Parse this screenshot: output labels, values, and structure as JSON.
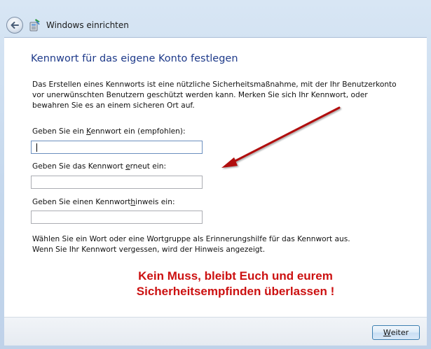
{
  "window": {
    "title": "Windows einrichten"
  },
  "page": {
    "heading": "Kennwort für das eigene Konto festlegen",
    "intro_lines": [
      "Das Erstellen eines Kennworts ist eine nützliche Sicherheitsmaßnahme, mit der Ihr Benutzerkonto",
      "vor unerwünschten Benutzern geschützt werden kann. Merken Sie sich Ihr Kennwort, oder",
      "bewahren Sie es an einem sicheren Ort auf."
    ],
    "password": {
      "label_before": "Geben Sie ein ",
      "label_accel": "K",
      "label_after": "ennwort ein (empfohlen):",
      "value": ""
    },
    "confirm": {
      "label_before": "Geben Sie das Kennwort ",
      "label_accel": "e",
      "label_after": "rneut ein:",
      "value": ""
    },
    "hint_field": {
      "label_before": "Geben Sie einen Kennwort",
      "label_accel": "h",
      "label_after": "inweis ein:",
      "value": ""
    },
    "hint_lines": [
      "Wählen Sie ein Wort oder eine Wortgruppe als Erinnerungshilfe für das Kennwort aus.",
      "Wenn Sie Ihr Kennwort vergessen, wird der Hinweis angezeigt."
    ],
    "annotation_lines": [
      "Kein Muss, bleibt Euch und eurem",
      "Sicherheitsempfinden überlassen !"
    ]
  },
  "footer": {
    "next_accel": "W",
    "next_rest": "eiter"
  },
  "colors": {
    "heading": "#1e3a8a",
    "annotation": "#cc1111",
    "arrow": "#b01010"
  },
  "icons": {
    "back": "back-arrow-icon",
    "setup": "windows-setup-icon"
  }
}
